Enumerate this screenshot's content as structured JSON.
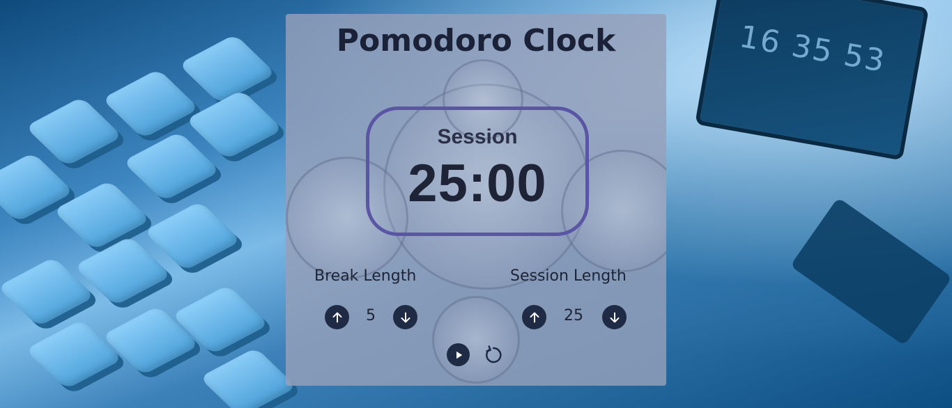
{
  "app": {
    "title": "Pomodoro Clock"
  },
  "background": {
    "laptop_clock": "16 35 53"
  },
  "display": {
    "label": "Session",
    "time": "25:00"
  },
  "break": {
    "label": "Break Length",
    "value": "5"
  },
  "session": {
    "label": "Session Length",
    "value": "25"
  },
  "icons": {
    "increment": "arrow-up-icon",
    "decrement": "arrow-down-icon",
    "play": "play-icon",
    "reset": "reset-icon"
  },
  "colors": {
    "card_bg": "#96a0b9",
    "display_border": "#5a55a5",
    "button_bg": "#1f2a44",
    "text": "#1e2436"
  }
}
